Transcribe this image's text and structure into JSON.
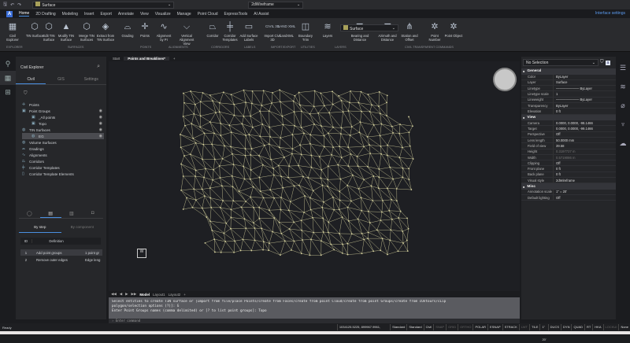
{
  "qat": {
    "layer": "Surface",
    "visual_style": "2dWireframe"
  },
  "menu": {
    "tabs": [
      "Home",
      "2D Drafting",
      "Modeling",
      "Insert",
      "Export",
      "Annotate",
      "View",
      "Visualize",
      "Manage",
      "Point Cloud",
      "ExpressTools",
      "AI Assist"
    ],
    "interface_settings": "Interface settings"
  },
  "ribbon": {
    "buttons": [
      {
        "label": "Civil Explorer",
        "icon": "▦"
      },
      {
        "label": "TIN Surface",
        "icon": "⬡"
      },
      {
        "label": "Edit TIN Surface",
        "icon": "⬡"
      },
      {
        "label": "Modify TIN Surface",
        "icon": "▲"
      },
      {
        "label": "Merge TIN Surfaces",
        "icon": "⬡"
      },
      {
        "label": "Extract from TIN Surface",
        "icon": "◈"
      },
      {
        "label": "Grading",
        "icon": "⌓"
      },
      {
        "label": "Points",
        "icon": "✛"
      },
      {
        "label": "Alignment by PI",
        "icon": "∿"
      },
      {
        "label": "Vertical Alignment View",
        "icon": "⌵"
      },
      {
        "label": "Corridor",
        "icon": "⏢"
      },
      {
        "label": "Corridor Templates",
        "icon": "╪"
      },
      {
        "label": "Add Surface Labels",
        "icon": "▭"
      },
      {
        "label": "Import Civil 3D",
        "icon": "CIVIL 3D"
      },
      {
        "label": "LandXML",
        "icon": "LAND XML"
      },
      {
        "label": "Boundary Trim",
        "icon": "◫"
      },
      {
        "label": "Layers",
        "icon": "≋"
      },
      {
        "label": "Bearing and Distance",
        "icon": "◤"
      },
      {
        "label": "Azimuth and Distance",
        "icon": "◥"
      },
      {
        "label": "Station and Offset",
        "icon": "⋔"
      },
      {
        "label": "Point Number",
        "icon": "✲"
      },
      {
        "label": "Point Object",
        "icon": "✲"
      }
    ],
    "groups": [
      "Explorer",
      "Surfaces",
      "Points",
      "Alignments",
      "Corridors",
      "Labels",
      "Import/Export",
      "Utilities",
      "Layers",
      "Civil Transparent Commands"
    ],
    "layer_combo": "Surface"
  },
  "left_panel": {
    "title": "Civil Explorer",
    "tabs": [
      "Civil",
      "GIS",
      "Settings"
    ],
    "tree": [
      {
        "label": "Points",
        "icon": "✛"
      },
      {
        "label": "Point Groups",
        "icon": "▣",
        "eye": true
      },
      {
        "label": "_All points",
        "icon": "▣",
        "eye": true,
        "indent": 2
      },
      {
        "label": "Topo",
        "icon": "▣",
        "eye": true,
        "indent": 2
      },
      {
        "label": "TIN Surfaces",
        "icon": "◍",
        "eye": true
      },
      {
        "label": "EG",
        "icon": "◍",
        "eye": true,
        "indent": 2,
        "selected": true
      },
      {
        "label": "Volume Surfaces",
        "icon": "◍"
      },
      {
        "label": "Gradings",
        "icon": "⌓"
      },
      {
        "label": "Alignments",
        "icon": "∿"
      },
      {
        "label": "Corridors",
        "icon": "⏢"
      },
      {
        "label": "Corridor Templates",
        "icon": "╪"
      },
      {
        "label": "Corridor Template Elements",
        "icon": "▯"
      }
    ],
    "sub_tabs": [
      "By step",
      "By component"
    ],
    "table_headers": [
      "ID",
      "Definition"
    ],
    "rows": [
      {
        "id": "1",
        "definition": "Add point groups",
        "value": "1 point gr"
      },
      {
        "id": "2",
        "definition": "Remove outer edges",
        "value": "Edge leng"
      }
    ]
  },
  "viewport": {
    "tabs": [
      "Start",
      "Points and Breaklines*",
      "+"
    ],
    "layout_tabs": [
      "Model",
      "Layout1",
      "Layout2",
      "+"
    ],
    "ucs": "W"
  },
  "command": {
    "lines": [
      "Select entities to create TIN surface or [Import from file/place Points/create from Faces/create from point Cloud/create from point Groups/create from cOntours/cLip",
      "polygon/selection options (?)]: G",
      "Enter Point Groups names (comma delimited) or [? to list point groups]: Topo"
    ],
    "prompt": "Enter command"
  },
  "status": {
    "ready": "Ready",
    "coords": "1034125.5225, 899967.9961, 0.0000",
    "items": [
      {
        "t": "Standard",
        "on": true
      },
      {
        "t": "Standard",
        "on": true
      },
      {
        "t": "Civil",
        "on": true
      },
      {
        "t": "SNAP",
        "on": false
      },
      {
        "t": "GRID",
        "on": false
      },
      {
        "t": "ORTHO",
        "on": false
      },
      {
        "t": "POLAR",
        "on": true
      },
      {
        "t": "ESNAP",
        "on": true
      },
      {
        "t": "STRACK",
        "on": true
      },
      {
        "t": "LWT",
        "on": false
      },
      {
        "t": "TILE",
        "on": true
      },
      {
        "t": "1\" = 20'",
        "on": true
      },
      {
        "t": "DUCS",
        "on": true
      },
      {
        "t": "DYN",
        "on": true
      },
      {
        "t": "QUAD",
        "on": true
      },
      {
        "t": "RT",
        "on": true
      },
      {
        "t": "HKA",
        "on": true
      },
      {
        "t": "LOCKUI",
        "on": false
      },
      {
        "t": "None",
        "on": true
      }
    ]
  },
  "properties": {
    "selection": "No Selection",
    "sections": [
      {
        "title": "General",
        "rows": [
          [
            "Color",
            "ByLayer"
          ],
          [
            "Layer",
            "Surface"
          ],
          [
            "Linetype",
            "——————— ByLayer"
          ],
          [
            "Linetype scale",
            "1"
          ],
          [
            "Lineweight",
            "——————— ByLayer"
          ],
          [
            "Transparency",
            "ByLayer"
          ],
          [
            "Elevation",
            "0 ft"
          ]
        ]
      },
      {
        "title": "View",
        "rows": [
          [
            "Camera",
            "0.0000, 0.0000, -98.1466"
          ],
          [
            "Target",
            "0.0000, 0.0000, -99.1466"
          ],
          [
            "Perspective",
            "Off"
          ],
          [
            "Lens length",
            "50.0000 mm"
          ],
          [
            "Field of view",
            "39.58"
          ],
          [
            "Height",
            "0.3197727 m"
          ],
          [
            "Width",
            "0.5719086 m"
          ],
          [
            "Clipping",
            "Off"
          ],
          [
            "Front plane",
            "0 ft"
          ],
          [
            "Back plane",
            "0 ft"
          ],
          [
            "Visual style",
            "2dWireframe"
          ]
        ]
      },
      {
        "title": "Misc",
        "rows": [
          [
            "Annotation scale",
            "1\" = 20'"
          ],
          [
            "Default lighting",
            "Off"
          ]
        ]
      }
    ]
  },
  "colors": {
    "accent": "#4a8fe0",
    "mesh": "#d8d4a0",
    "bg": "#1e1f23"
  }
}
